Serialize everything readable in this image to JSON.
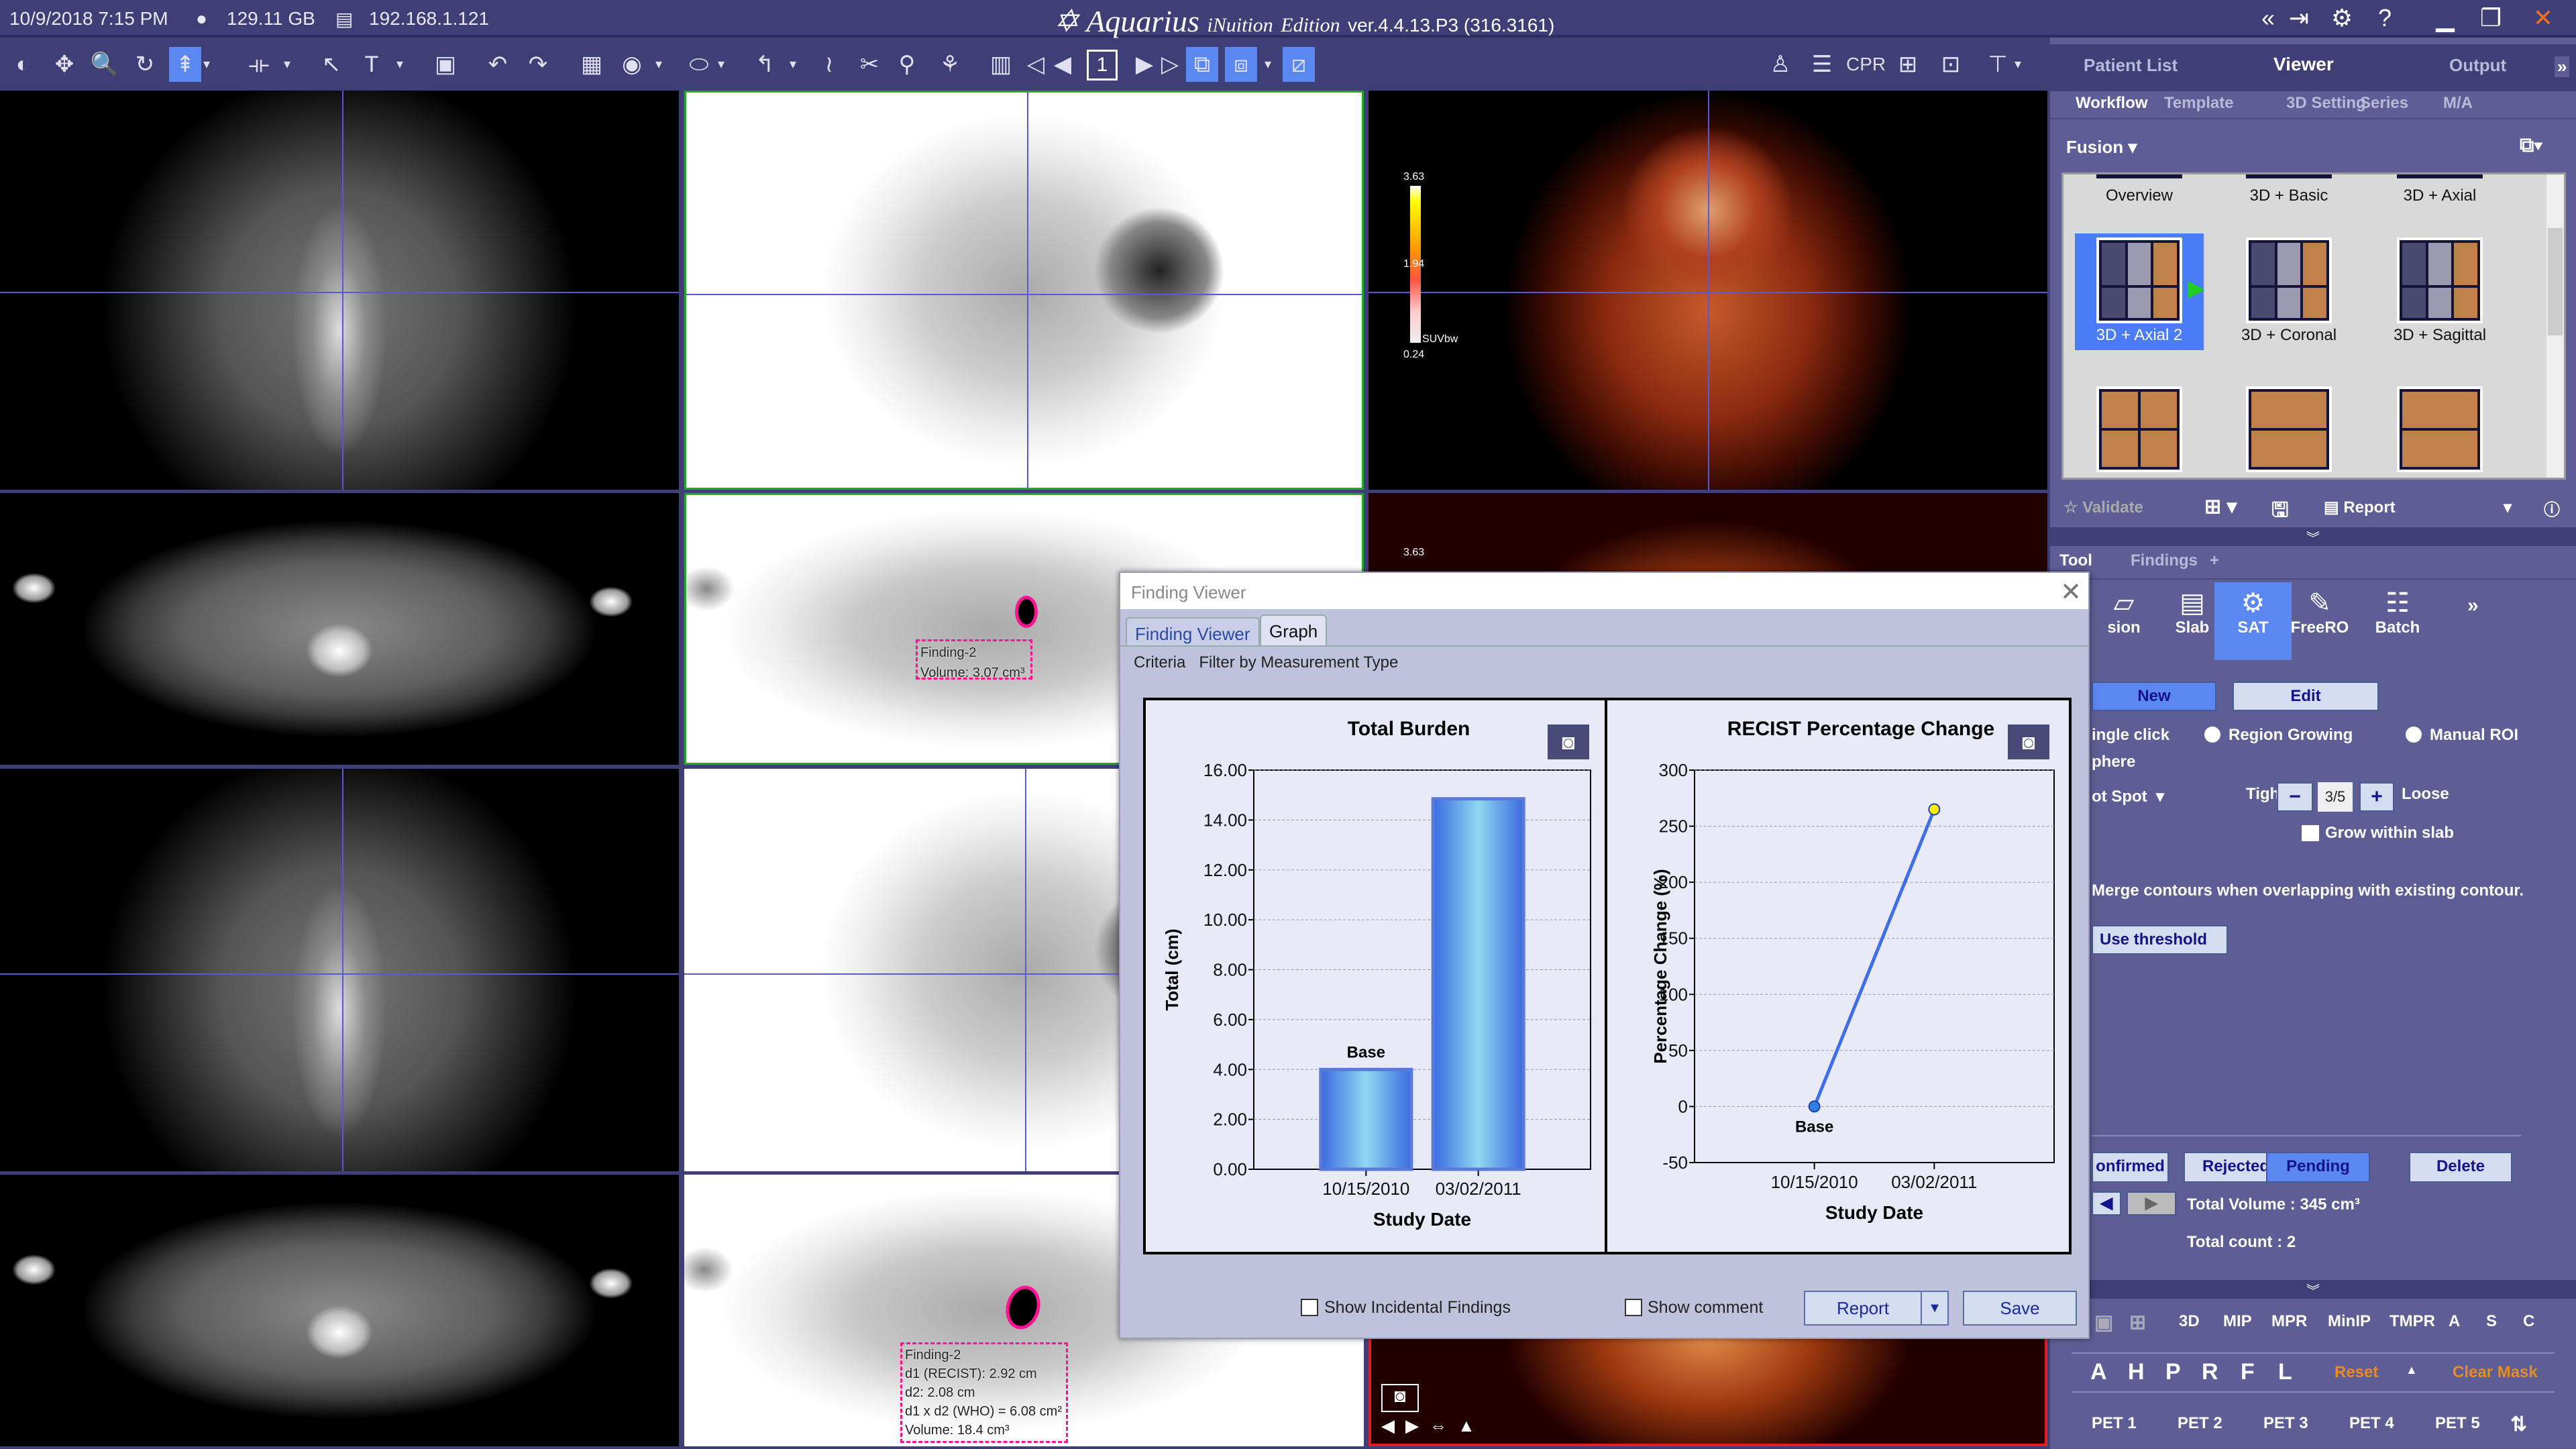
{
  "titlebar": {
    "datetime": "10/9/2018  7:15 PM",
    "disk": "129.11 GB",
    "ip": "192.168.1.121",
    "app_name": "Aquarius",
    "edition_prefix": "iNuition",
    "edition": "Edition",
    "version": "ver.4.4.13.P3 (316.3161)"
  },
  "toolbar": {
    "page": "1",
    "cpr": "CPR",
    "icons": [
      "window-level-icon",
      "pan-icon",
      "zoom-icon",
      "rotate-icon",
      "select-tool-icon",
      "dropdown-icon",
      "ruler-icon",
      "dropdown-icon",
      "pointer-icon",
      "text-icon",
      "dropdown-icon",
      "slab-icon",
      "undo-icon",
      "redo-icon",
      "color-map-icon",
      "roi-icon",
      "dropdown-icon",
      "ellipse-icon",
      "dropdown-icon",
      "curve-icon",
      "dropdown-icon",
      "vessel-icon",
      "cut-icon",
      "probe-icon",
      "segment-icon",
      "cine-icon",
      "first-icon",
      "prev-icon",
      "next-icon",
      "last-icon",
      "link-icon",
      "sync-icon",
      "dropdown-icon",
      "fusion-icon"
    ],
    "right_icons": [
      "person-icon",
      "list-icon",
      "cpr-icon",
      "crosshair-icon",
      "magnify-icon",
      "layout-icon",
      "dropdown-icon"
    ]
  },
  "viewports": {
    "colorbar": {
      "max": "3.63",
      "mid": "1.94",
      "min": "0.24",
      "unit": "SUVbw"
    },
    "finding_top": {
      "name": "Finding-2",
      "volume": "Volume: 3.07 cm³"
    },
    "finding_bottom": {
      "name": "Finding-2",
      "d1": "d1 (RECIST): 2.92 cm",
      "d2": "d2: 2.08 cm",
      "who": "d1 x d2 (WHO) = 6.08 cm²",
      "volume": "Volume: 18.4 cm³"
    },
    "small_colorbar_label": "3.63"
  },
  "dialog": {
    "title": "Finding Viewer",
    "tabs": [
      {
        "label": "Finding Viewer",
        "active": false
      },
      {
        "label": "Graph",
        "active": true
      }
    ],
    "criteria_label": "Criteria",
    "criteria_value": "Filter by Measurement Type",
    "show_incidental": {
      "label": "Show Incidental Findings",
      "checked": false
    },
    "show_comment": {
      "label": "Show comment",
      "checked": false
    },
    "report_label": "Report",
    "save_label": "Save"
  },
  "chart_data": [
    {
      "type": "bar",
      "title": "Total Burden",
      "xlabel": "Study Date",
      "ylabel": "Total (cm)",
      "categories": [
        "10/15/2010",
        "03/02/2011"
      ],
      "values": [
        4.0,
        14.85
      ],
      "bar_labels": [
        "Base",
        ""
      ],
      "ylim": [
        0,
        16
      ],
      "y_ticks": [
        "0.00",
        "2.00",
        "4.00",
        "6.00",
        "8.00",
        "10.00",
        "12.00",
        "14.00",
        "16.00"
      ],
      "grid": true,
      "bar_color": "#4a7be8"
    },
    {
      "type": "line",
      "title": "RECIST Percentage Change",
      "xlabel": "Study Date",
      "ylabel": "Percentage Change (%)",
      "categories": [
        "10/15/2010",
        "03/02/2011"
      ],
      "values": [
        0,
        265
      ],
      "point_labels": [
        "Base",
        ""
      ],
      "point_colors": [
        "#2f7fe0",
        "#ffee00"
      ],
      "ylim": [
        -50,
        300
      ],
      "y_ticks": [
        "-50",
        "0",
        "50",
        "100",
        "150",
        "200",
        "250",
        "300"
      ],
      "grid": true,
      "line_color": "#3f6ee8"
    }
  ],
  "panel": {
    "tabs": [
      {
        "label": "Patient List"
      },
      {
        "label": "Viewer",
        "active": true
      },
      {
        "label": "Output"
      }
    ],
    "subtabs": [
      {
        "label": "Workflow",
        "active": true
      },
      {
        "label": "Template"
      },
      {
        "label": "3D Setting"
      },
      {
        "label": "Series"
      },
      {
        "label": "M/A"
      }
    ],
    "workflow_dropdown": "Fusion",
    "layouts": [
      {
        "label": "Overview"
      },
      {
        "label": "3D + Basic"
      },
      {
        "label": "3D + Axial"
      },
      {
        "label": "3D + Axial 2",
        "selected": true
      },
      {
        "label": "3D + Coronal"
      },
      {
        "label": "3D + Sagittal"
      }
    ],
    "validate": "Validate",
    "report": "Report",
    "tool_tabs": [
      {
        "label": "Tool",
        "active": true
      },
      {
        "label": "Findings"
      },
      {
        "label": "+"
      }
    ],
    "tools": [
      {
        "label": "sion"
      },
      {
        "label": "Slab"
      },
      {
        "label": "SAT",
        "active": true
      },
      {
        "label": "FreeRO"
      },
      {
        "label": "Batch"
      }
    ],
    "new_label": "New",
    "edit_label": "Edit",
    "single_click": "ingle click",
    "region_growing": "Region Growing",
    "manual_roi": "Manual ROI",
    "sphere": "phere",
    "hot_spot": "ot Spot",
    "tight": "Tight",
    "loose": "Loose",
    "level": "3/5",
    "grow_within_slab": "Grow within slab",
    "merge": "Merge contours when overlapping with existing contour.",
    "use_threshold": "Use threshold",
    "status_buttons": [
      {
        "label": "onfirmed"
      },
      {
        "label": "Rejected"
      },
      {
        "label": "Pending",
        "active": true
      },
      {
        "label": "Delete"
      }
    ],
    "total_volume": "Total Volume :  345 cm³",
    "total_count": "Total count : 2",
    "render_modes": [
      "3D",
      "MIP",
      "MPR",
      "MinIP",
      "TMPR",
      "A",
      "S",
      "C"
    ],
    "orientations": [
      "A",
      "H",
      "P",
      "R",
      "F",
      "L"
    ],
    "reset": "Reset",
    "clear_mask": "Clear Mask",
    "pet_presets": [
      "PET 1",
      "PET 2",
      "PET 3",
      "PET 4",
      "PET 5"
    ],
    "accent": "#5b87f0",
    "warning": "#e88a2a"
  }
}
